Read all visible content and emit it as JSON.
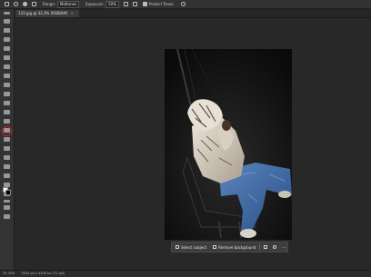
{
  "options_bar": {
    "range_label": "Range:",
    "range_value": "Midtones",
    "exposure_label": "Exposure:",
    "exposure_value": "50%",
    "protect_tones_label": "Protect Tones"
  },
  "document_tab": {
    "title": "133.jpg @ 33.3% (RGB/8#)",
    "close_symbol": "×"
  },
  "context_bar": {
    "select_subject_label": "Select subject",
    "remove_background_label": "Remove background",
    "more_symbol": "···"
  },
  "status_bar": {
    "zoom": "33.33%",
    "doc_info": "3024 px x 4536 px (72 ppi)"
  },
  "colors": {
    "foreground": "#ffffff",
    "background": "#000000",
    "highlight_ring": "#d02020"
  },
  "icons": {
    "home": "home-icon",
    "tool_preset": "dodge-icon",
    "brush_options": "brush-preset-icon",
    "airbrush": "airbrush-icon",
    "angle": "angle-icon",
    "pressure": "pressure-icon",
    "share": "share-icon"
  }
}
